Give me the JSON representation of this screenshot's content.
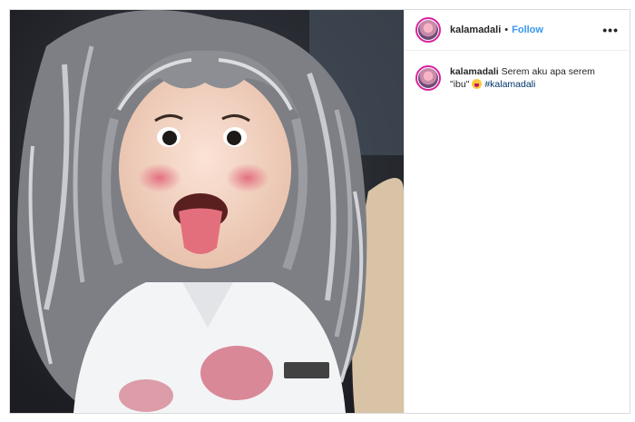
{
  "post": {
    "username": "kalamadali",
    "separator": "•",
    "follow_label": "Follow",
    "more_label": "•••",
    "caption": {
      "username": "kalamadali",
      "text_line1": "Serem aku apa serem",
      "text_line2": "\"ibu\"",
      "emoji": "face-with-tongue",
      "hashtag": "#kalamadali"
    }
  }
}
